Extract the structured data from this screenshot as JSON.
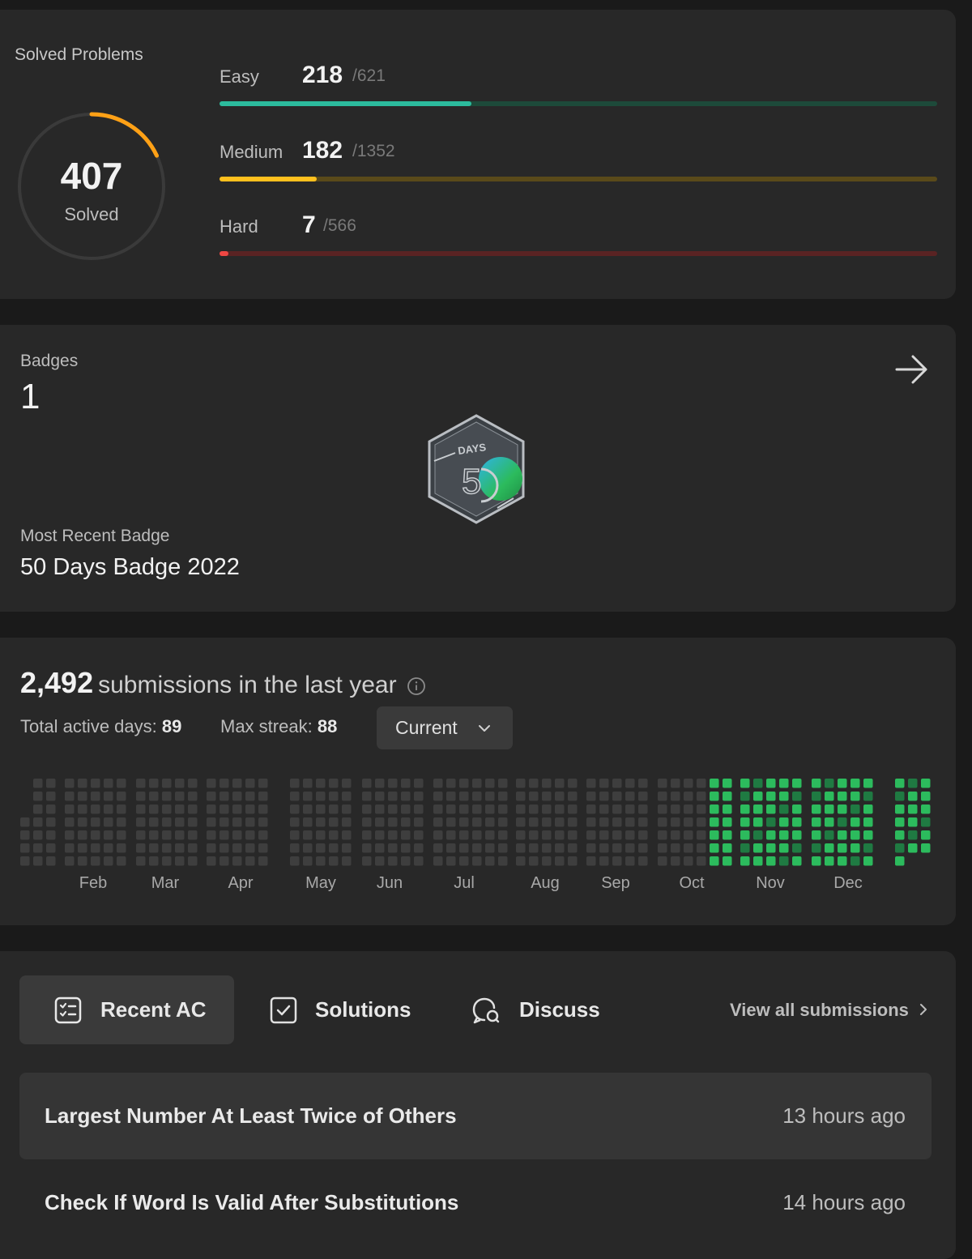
{
  "solved": {
    "title": "Solved Problems",
    "count": "407",
    "count_label": "Solved",
    "ring_fraction": 0.18,
    "difficulties": [
      {
        "label": "Easy",
        "solved": "218",
        "total": "/621",
        "fraction": 0.351,
        "color": "#2cbb9d",
        "track_color": "#1d4a3a"
      },
      {
        "label": "Medium",
        "solved": "182",
        "total": "/1352",
        "fraction": 0.135,
        "color": "#ffc01e",
        "track_color": "#5a4a1a"
      },
      {
        "label": "Hard",
        "solved": "7",
        "total": "/566",
        "fraction": 0.012,
        "color": "#ef4743",
        "track_color": "#5a2323"
      }
    ]
  },
  "badges": {
    "label": "Badges",
    "count": "1",
    "badge_art_text": "DAYS 50",
    "recent_label": "Most Recent Badge",
    "recent_name": "50 Days Badge 2022"
  },
  "submissions": {
    "count": "2,492",
    "text": "submissions in the last year",
    "active_days_label": "Total active days:",
    "active_days": "89",
    "max_streak_label": "Max streak:",
    "max_streak": "88",
    "period_select": "Current",
    "months": [
      "Feb",
      "Mar",
      "Apr",
      "May",
      "Jun",
      "Jul",
      "Aug",
      "Sep",
      "Oct",
      "Nov",
      "Dec"
    ],
    "active_color": "#2cbb5d",
    "inactive_color": "#3e3e3e"
  },
  "recent": {
    "tabs": [
      {
        "label": "Recent AC",
        "icon": "list-check-icon"
      },
      {
        "label": "Solutions",
        "icon": "checkbox-icon"
      },
      {
        "label": "Discuss",
        "icon": "discuss-icon"
      }
    ],
    "view_all": "View all submissions",
    "items": [
      {
        "title": "Largest Number At Least Twice of Others",
        "time": "13 hours ago"
      },
      {
        "title": "Check If Word Is Valid After Substitutions",
        "time": "14 hours ago"
      }
    ]
  }
}
